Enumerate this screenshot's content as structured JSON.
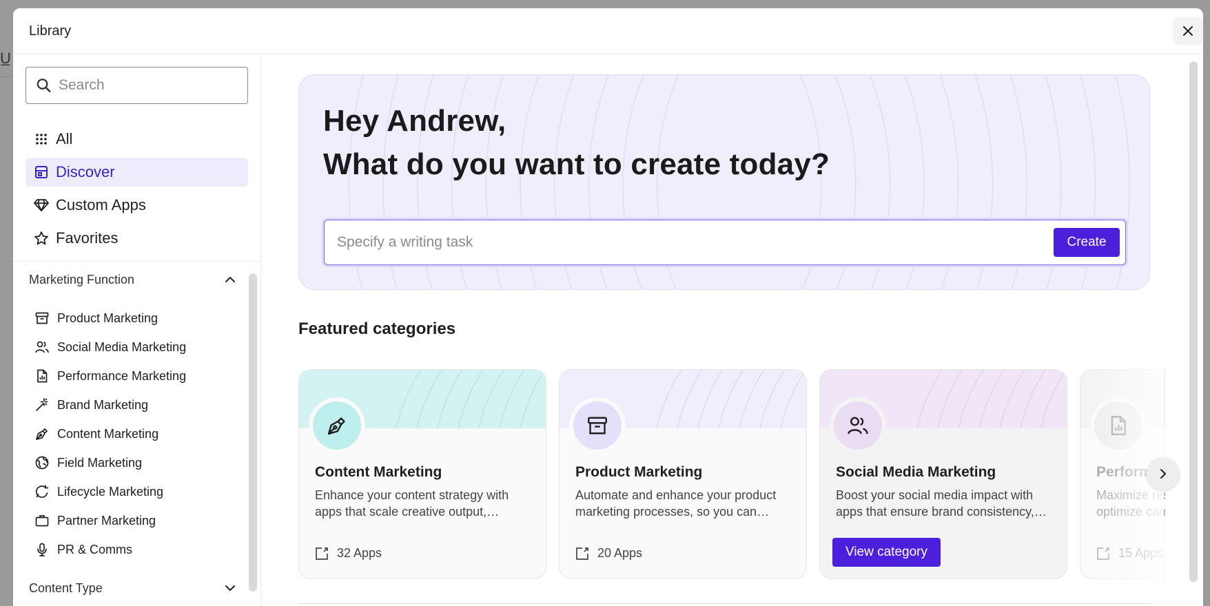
{
  "modal": {
    "title": "Library"
  },
  "search": {
    "placeholder": "Search"
  },
  "nav": [
    {
      "label": "All",
      "icon": "grid-icon"
    },
    {
      "label": "Discover",
      "icon": "storefront-icon",
      "active": true
    },
    {
      "label": "Custom Apps",
      "icon": "diamond-icon"
    },
    {
      "label": "Favorites",
      "icon": "star-icon"
    }
  ],
  "groups": {
    "marketing_function": {
      "label": "Marketing Function",
      "expanded": true,
      "items": [
        {
          "label": "Product Marketing",
          "icon": "archive-box-icon"
        },
        {
          "label": "Social Media Marketing",
          "icon": "users-icon"
        },
        {
          "label": "Performance Marketing",
          "icon": "chart-file-icon"
        },
        {
          "label": "Brand Marketing",
          "icon": "magic-wand-icon"
        },
        {
          "label": "Content Marketing",
          "icon": "pen-nib-icon"
        },
        {
          "label": "Field Marketing",
          "icon": "globe-icon"
        },
        {
          "label": "Lifecycle Marketing",
          "icon": "chat-cycle-icon"
        },
        {
          "label": "Partner Marketing",
          "icon": "briefcase-icon"
        },
        {
          "label": "PR & Comms",
          "icon": "microphone-icon"
        }
      ]
    },
    "content_type": {
      "label": "Content Type",
      "expanded": false
    }
  },
  "hero": {
    "greeting": "Hey Andrew,",
    "question": "What do you want to create today?",
    "prompt_placeholder": "Specify a writing task",
    "create_label": "Create"
  },
  "featured": {
    "title": "Featured categories",
    "view_label": "View category",
    "cards": [
      {
        "title": "Content Marketing",
        "desc": "Enhance your content strategy with apps that scale creative output, ensuring engaging content.",
        "count": "32 Apps",
        "accent": "#bfeeee",
        "icon": "pen-nib-icon"
      },
      {
        "title": "Product Marketing",
        "desc": "Automate and enhance your product marketing processes, so you can focus on strategy.",
        "count": "20 Apps",
        "accent": "#e3e1fa",
        "icon": "archive-box-icon"
      },
      {
        "title": "Social Media Marketing",
        "desc": "Boost your social media impact with apps that ensure brand consistency, everywhere.",
        "count": "",
        "accent": "#eadcf3",
        "icon": "users-icon"
      },
      {
        "title": "Performance Marketing",
        "desc": "Maximize results with apps that let you optimize campaigns.",
        "count": "15 Apps",
        "accent": "#ececec",
        "icon": "chart-file-icon"
      }
    ]
  },
  "colors": {
    "accent": "#4b1fdb",
    "active_bg": "#ececfc",
    "hero_bg": "#efeefc"
  }
}
